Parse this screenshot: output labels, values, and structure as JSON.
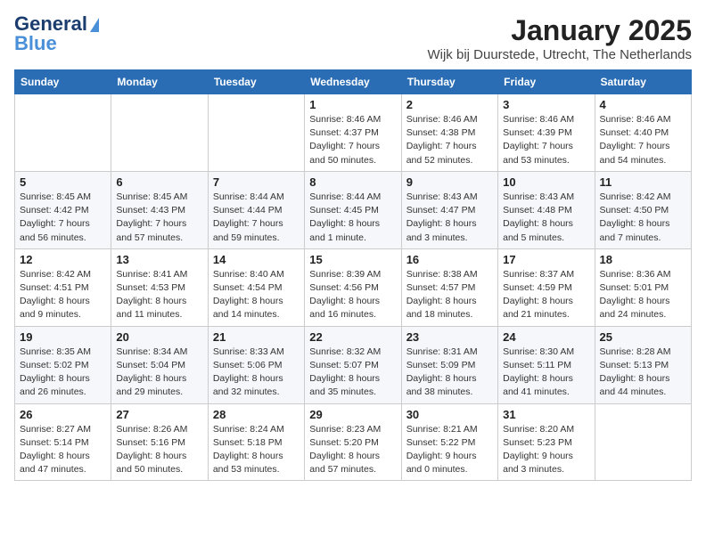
{
  "header": {
    "logo_line1": "General",
    "logo_line2": "Blue",
    "month": "January 2025",
    "location": "Wijk bij Duurstede, Utrecht, The Netherlands"
  },
  "weekdays": [
    "Sunday",
    "Monday",
    "Tuesday",
    "Wednesday",
    "Thursday",
    "Friday",
    "Saturday"
  ],
  "weeks": [
    [
      {
        "day": "",
        "content": ""
      },
      {
        "day": "",
        "content": ""
      },
      {
        "day": "",
        "content": ""
      },
      {
        "day": "1",
        "content": "Sunrise: 8:46 AM\nSunset: 4:37 PM\nDaylight: 7 hours\nand 50 minutes."
      },
      {
        "day": "2",
        "content": "Sunrise: 8:46 AM\nSunset: 4:38 PM\nDaylight: 7 hours\nand 52 minutes."
      },
      {
        "day": "3",
        "content": "Sunrise: 8:46 AM\nSunset: 4:39 PM\nDaylight: 7 hours\nand 53 minutes."
      },
      {
        "day": "4",
        "content": "Sunrise: 8:46 AM\nSunset: 4:40 PM\nDaylight: 7 hours\nand 54 minutes."
      }
    ],
    [
      {
        "day": "5",
        "content": "Sunrise: 8:45 AM\nSunset: 4:42 PM\nDaylight: 7 hours\nand 56 minutes."
      },
      {
        "day": "6",
        "content": "Sunrise: 8:45 AM\nSunset: 4:43 PM\nDaylight: 7 hours\nand 57 minutes."
      },
      {
        "day": "7",
        "content": "Sunrise: 8:44 AM\nSunset: 4:44 PM\nDaylight: 7 hours\nand 59 minutes."
      },
      {
        "day": "8",
        "content": "Sunrise: 8:44 AM\nSunset: 4:45 PM\nDaylight: 8 hours\nand 1 minute."
      },
      {
        "day": "9",
        "content": "Sunrise: 8:43 AM\nSunset: 4:47 PM\nDaylight: 8 hours\nand 3 minutes."
      },
      {
        "day": "10",
        "content": "Sunrise: 8:43 AM\nSunset: 4:48 PM\nDaylight: 8 hours\nand 5 minutes."
      },
      {
        "day": "11",
        "content": "Sunrise: 8:42 AM\nSunset: 4:50 PM\nDaylight: 8 hours\nand 7 minutes."
      }
    ],
    [
      {
        "day": "12",
        "content": "Sunrise: 8:42 AM\nSunset: 4:51 PM\nDaylight: 8 hours\nand 9 minutes."
      },
      {
        "day": "13",
        "content": "Sunrise: 8:41 AM\nSunset: 4:53 PM\nDaylight: 8 hours\nand 11 minutes."
      },
      {
        "day": "14",
        "content": "Sunrise: 8:40 AM\nSunset: 4:54 PM\nDaylight: 8 hours\nand 14 minutes."
      },
      {
        "day": "15",
        "content": "Sunrise: 8:39 AM\nSunset: 4:56 PM\nDaylight: 8 hours\nand 16 minutes."
      },
      {
        "day": "16",
        "content": "Sunrise: 8:38 AM\nSunset: 4:57 PM\nDaylight: 8 hours\nand 18 minutes."
      },
      {
        "day": "17",
        "content": "Sunrise: 8:37 AM\nSunset: 4:59 PM\nDaylight: 8 hours\nand 21 minutes."
      },
      {
        "day": "18",
        "content": "Sunrise: 8:36 AM\nSunset: 5:01 PM\nDaylight: 8 hours\nand 24 minutes."
      }
    ],
    [
      {
        "day": "19",
        "content": "Sunrise: 8:35 AM\nSunset: 5:02 PM\nDaylight: 8 hours\nand 26 minutes."
      },
      {
        "day": "20",
        "content": "Sunrise: 8:34 AM\nSunset: 5:04 PM\nDaylight: 8 hours\nand 29 minutes."
      },
      {
        "day": "21",
        "content": "Sunrise: 8:33 AM\nSunset: 5:06 PM\nDaylight: 8 hours\nand 32 minutes."
      },
      {
        "day": "22",
        "content": "Sunrise: 8:32 AM\nSunset: 5:07 PM\nDaylight: 8 hours\nand 35 minutes."
      },
      {
        "day": "23",
        "content": "Sunrise: 8:31 AM\nSunset: 5:09 PM\nDaylight: 8 hours\nand 38 minutes."
      },
      {
        "day": "24",
        "content": "Sunrise: 8:30 AM\nSunset: 5:11 PM\nDaylight: 8 hours\nand 41 minutes."
      },
      {
        "day": "25",
        "content": "Sunrise: 8:28 AM\nSunset: 5:13 PM\nDaylight: 8 hours\nand 44 minutes."
      }
    ],
    [
      {
        "day": "26",
        "content": "Sunrise: 8:27 AM\nSunset: 5:14 PM\nDaylight: 8 hours\nand 47 minutes."
      },
      {
        "day": "27",
        "content": "Sunrise: 8:26 AM\nSunset: 5:16 PM\nDaylight: 8 hours\nand 50 minutes."
      },
      {
        "day": "28",
        "content": "Sunrise: 8:24 AM\nSunset: 5:18 PM\nDaylight: 8 hours\nand 53 minutes."
      },
      {
        "day": "29",
        "content": "Sunrise: 8:23 AM\nSunset: 5:20 PM\nDaylight: 8 hours\nand 57 minutes."
      },
      {
        "day": "30",
        "content": "Sunrise: 8:21 AM\nSunset: 5:22 PM\nDaylight: 9 hours\nand 0 minutes."
      },
      {
        "day": "31",
        "content": "Sunrise: 8:20 AM\nSunset: 5:23 PM\nDaylight: 9 hours\nand 3 minutes."
      },
      {
        "day": "",
        "content": ""
      }
    ]
  ]
}
